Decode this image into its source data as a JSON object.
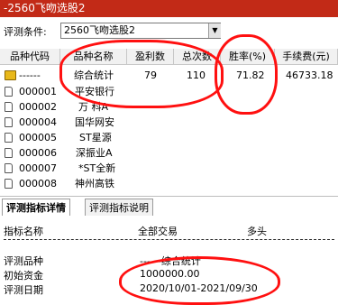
{
  "window": {
    "title": "-2560飞吻选股2"
  },
  "condition": {
    "label": "评测条件:",
    "value": "2560飞吻选股2"
  },
  "table": {
    "columns": [
      "品种代码",
      "品种名称",
      "盈利数",
      "总次数",
      "胜率(%)",
      "手续费(元)"
    ],
    "summary": {
      "code": "------",
      "name": "综合统计",
      "wins": "79",
      "total": "110",
      "winrate": "71.82",
      "fee": "46733.18"
    },
    "rows": [
      {
        "code": "000001",
        "name": "平安银行"
      },
      {
        "code": "000002",
        "name": "万 科A"
      },
      {
        "code": "000004",
        "name": "国华网安"
      },
      {
        "code": "000005",
        "name": "ST星源"
      },
      {
        "code": "000006",
        "name": "深振业A"
      },
      {
        "code": "000007",
        "name": "*ST全新"
      },
      {
        "code": "000008",
        "name": "神州高铁"
      }
    ]
  },
  "tabs": [
    {
      "label": "评测指标详情",
      "active": true
    },
    {
      "label": "评测指标说明",
      "active": false
    }
  ],
  "detail": {
    "headers": {
      "name": "指标名称",
      "all": "全部交易",
      "long": "多头"
    },
    "rows": [
      {
        "label": "评测品种",
        "value": "------综合统计"
      },
      {
        "label": "初始资金",
        "value": "1000000.00"
      },
      {
        "label": "评测日期",
        "value": "2020/10/01-2021/09/30"
      }
    ]
  },
  "annotation_color": "#ff1010"
}
